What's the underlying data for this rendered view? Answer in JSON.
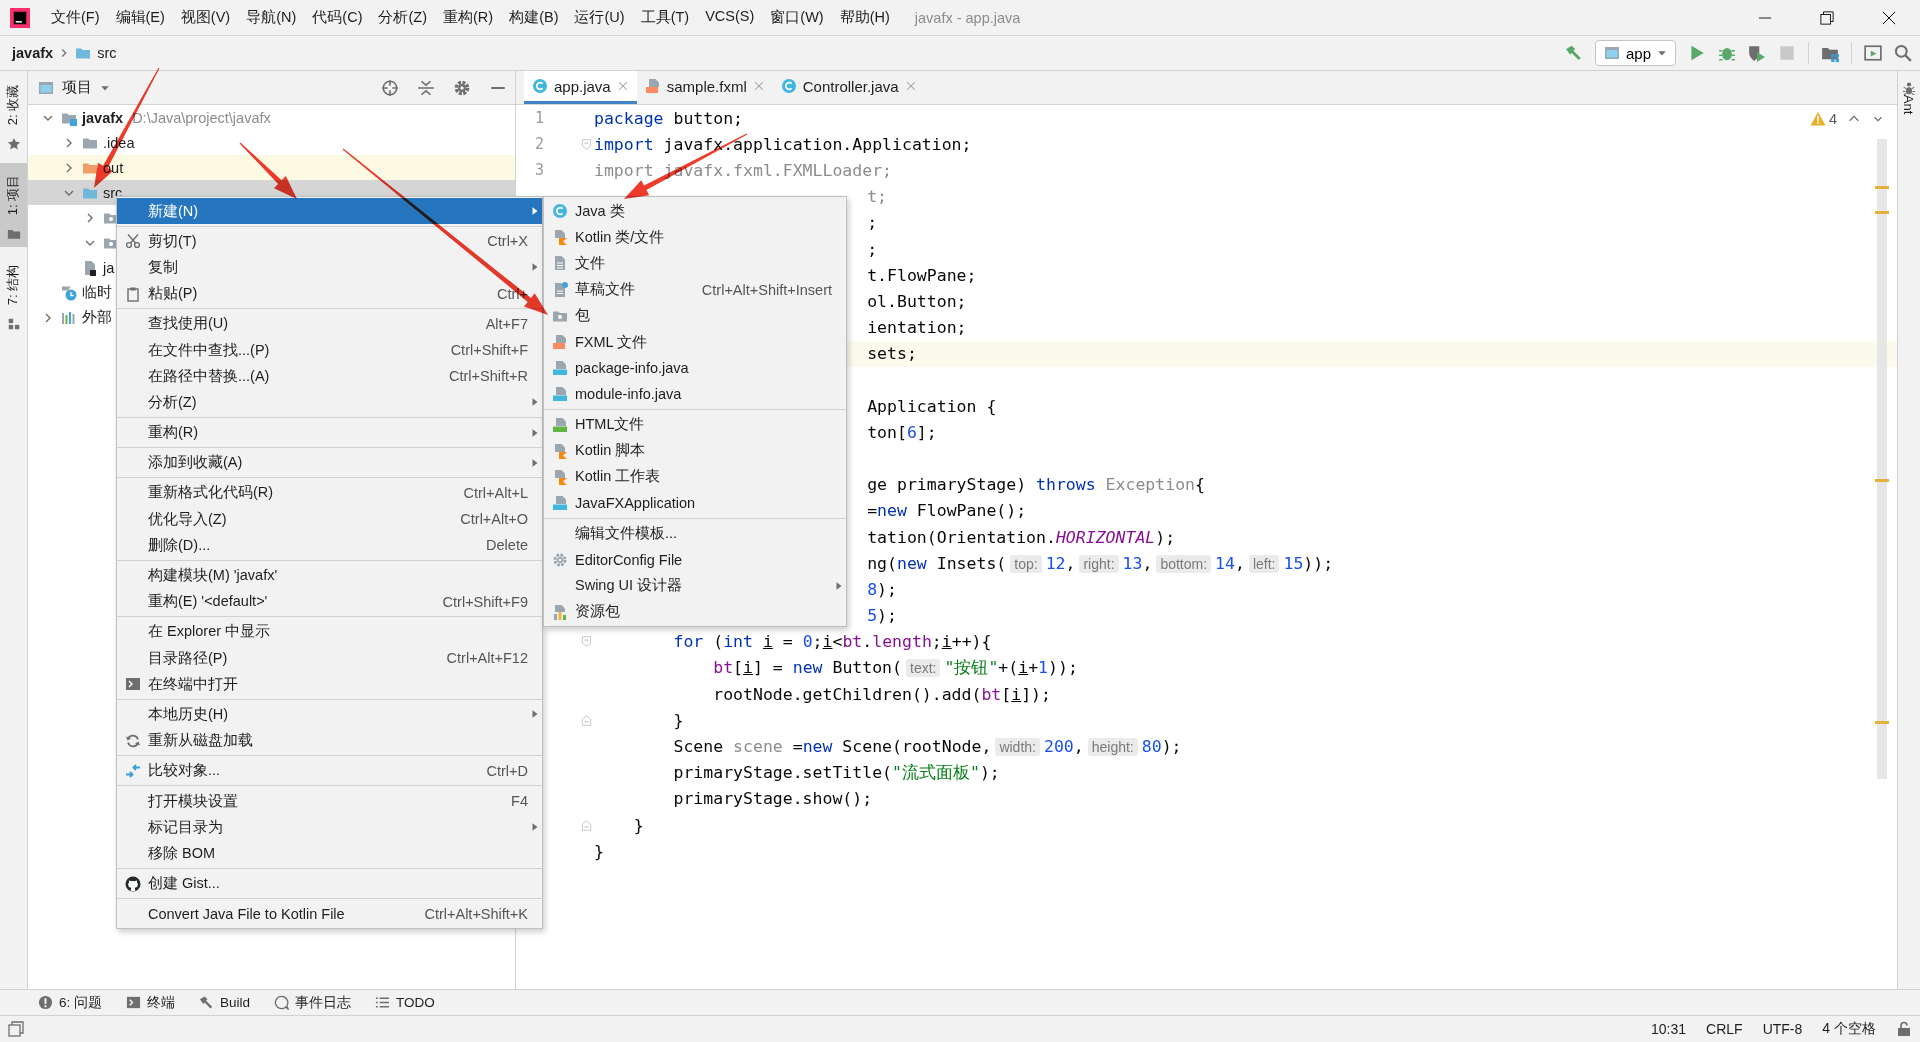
{
  "title_bar": {
    "menus": [
      "文件(F)",
      "编辑(E)",
      "视图(V)",
      "导航(N)",
      "代码(C)",
      "分析(Z)",
      "重构(R)",
      "构建(B)",
      "运行(U)",
      "工具(T)",
      "VCS(S)",
      "窗口(W)",
      "帮助(H)"
    ],
    "title": "javafx - app.java"
  },
  "nav_bar": {
    "breadcrumb": [
      "javafx",
      "src"
    ],
    "run_config": "app"
  },
  "left_strip": [
    {
      "label": "2: 收藏",
      "kind": "favorites",
      "selected": false
    },
    {
      "label": "1: 项目",
      "kind": "project",
      "selected": true
    },
    {
      "label": "7: 结构",
      "kind": "structure",
      "selected": false
    }
  ],
  "project_panel": {
    "title": "项目",
    "tree": [
      {
        "label": "javafx",
        "path": "D:\\Java\\project\\javafx",
        "kind": "module",
        "expanded": true,
        "selected": false,
        "children": [
          {
            "label": ".idea",
            "kind": "folder",
            "expanded": false,
            "selected": false
          },
          {
            "label": "out",
            "kind": "excluded",
            "expanded": false,
            "selected": false
          },
          {
            "label": "src",
            "kind": "source",
            "expanded": true,
            "selected": true,
            "children": [
              {
                "kind": "package",
                "expanded": false,
                "selected": false
              },
              {
                "kind": "package",
                "expanded": true,
                "selected": false
              }
            ]
          },
          {
            "label": "ja",
            "kind": "iml",
            "selected": false
          }
        ]
      },
      {
        "label": "临时",
        "kind": "scratches",
        "selected": false
      },
      {
        "label": "外部",
        "kind": "libraries",
        "expanded": false,
        "selected": false
      }
    ]
  },
  "editor": {
    "tabs": [
      {
        "label": "app.java",
        "kind": "class",
        "selected": true
      },
      {
        "label": "sample.fxml",
        "kind": "fxml",
        "selected": false
      },
      {
        "label": "Controller.java",
        "kind": "class",
        "selected": false
      }
    ],
    "warnings": "4",
    "lines": [
      {
        "kind": "full",
        "number": "1",
        "current": false,
        "tokens": [
          {
            "kind": "kw",
            "text": "package"
          },
          {
            "kind": "p",
            "text": " button;"
          }
        ]
      },
      {
        "kind": "full",
        "number": "2",
        "current": false,
        "fold_start": true,
        "tokens": [
          {
            "kind": "kw",
            "text": "import"
          },
          {
            "kind": "p",
            "text": " javafx.application.Application;"
          }
        ]
      },
      {
        "kind": "full",
        "number": "3",
        "current": false,
        "tokens": [
          {
            "kind": "grey",
            "text": "import javafx.fxml.FXMLLoader;"
          }
        ]
      },
      {
        "kind": "clipped",
        "current": false,
        "tokens": [
          {
            "kind": "grey",
            "text": "t;"
          }
        ]
      },
      {
        "kind": "clipped",
        "current": false,
        "tokens": [
          {
            "kind": "p",
            "text": ";"
          }
        ]
      },
      {
        "kind": "clipped",
        "current": false,
        "tokens": [
          {
            "kind": "p",
            "text": ";"
          }
        ]
      },
      {
        "kind": "clipped",
        "current": false,
        "tokens": [
          {
            "kind": "p",
            "text": "t.FlowPane;"
          }
        ]
      },
      {
        "kind": "clipped",
        "current": false,
        "tokens": [
          {
            "kind": "p",
            "text": "ol.Button;"
          }
        ]
      },
      {
        "kind": "clipped",
        "current": false,
        "tokens": [
          {
            "kind": "p",
            "text": "ientation;"
          }
        ]
      },
      {
        "kind": "clipped",
        "current": true,
        "tokens": [
          {
            "kind": "p",
            "text": "sets;"
          }
        ]
      },
      {
        "kind": "blank"
      },
      {
        "kind": "clipped",
        "current": false,
        "tokens": [
          {
            "kind": "p",
            "text": "Application {"
          }
        ]
      },
      {
        "kind": "clipped",
        "current": false,
        "tokens": [
          {
            "kind": "p",
            "text": "ton["
          },
          {
            "kind": "num",
            "text": "6"
          },
          {
            "kind": "p",
            "text": "];"
          }
        ]
      },
      {
        "kind": "blank"
      },
      {
        "kind": "clipped",
        "current": false,
        "tokens": [
          {
            "kind": "p",
            "text": "ge primaryStage) "
          },
          {
            "kind": "kw",
            "text": "throws"
          },
          {
            "kind": "grey",
            "text": " Exception"
          },
          {
            "kind": "p",
            "text": "{"
          }
        ]
      },
      {
        "kind": "clipped",
        "current": false,
        "tokens": [
          {
            "kind": "p",
            "text": "="
          },
          {
            "kind": "kw",
            "text": "new"
          },
          {
            "kind": "p",
            "text": " FlowPane();"
          }
        ]
      },
      {
        "kind": "clipped",
        "current": false,
        "tokens": [
          {
            "kind": "p",
            "text": "tation(Orientation."
          },
          {
            "kind": "const",
            "text": "HORIZONTAL"
          },
          {
            "kind": "p",
            "text": ");"
          }
        ]
      },
      {
        "kind": "clipped",
        "current": false,
        "tokens": [
          {
            "kind": "p",
            "text": "ng("
          },
          {
            "kind": "kw",
            "text": "new"
          },
          {
            "kind": "p",
            "text": " Insets("
          },
          {
            "kind": "hint",
            "text": "top:"
          },
          {
            "kind": "num",
            "text": "12"
          },
          {
            "kind": "p",
            "text": ","
          },
          {
            "kind": "hint",
            "text": "right:"
          },
          {
            "kind": "num",
            "text": "13"
          },
          {
            "kind": "p",
            "text": ","
          },
          {
            "kind": "hint",
            "text": "bottom:"
          },
          {
            "kind": "num",
            "text": "14"
          },
          {
            "kind": "p",
            "text": ","
          },
          {
            "kind": "hint",
            "text": "left:"
          },
          {
            "kind": "num",
            "text": "15"
          },
          {
            "kind": "p",
            "text": "));"
          }
        ]
      },
      {
        "kind": "clipped",
        "current": false,
        "tokens": [
          {
            "kind": "num",
            "text": "8"
          },
          {
            "kind": "p",
            "text": ");"
          }
        ]
      },
      {
        "kind": "clipped",
        "current": false,
        "tokens": [
          {
            "kind": "num",
            "text": "5"
          },
          {
            "kind": "p",
            "text": ");"
          }
        ]
      },
      {
        "kind": "full",
        "current": false,
        "fold_start": true,
        "tokens": [
          {
            "kind": "kw",
            "text": "        for"
          },
          {
            "kind": "p",
            "text": " ("
          },
          {
            "kind": "kw",
            "text": "int "
          },
          {
            "kind": "var",
            "text": "i"
          },
          {
            "kind": "p",
            "text": " = "
          },
          {
            "kind": "num",
            "text": "0"
          },
          {
            "kind": "p",
            "text": ";"
          },
          {
            "kind": "var",
            "text": "i"
          },
          {
            "kind": "p",
            "text": "<"
          },
          {
            "kind": "field",
            "text": "bt"
          },
          {
            "kind": "p",
            "text": "."
          },
          {
            "kind": "field",
            "text": "length"
          },
          {
            "kind": "p",
            "text": ";"
          },
          {
            "kind": "var",
            "text": "i"
          },
          {
            "kind": "p",
            "text": "++){"
          }
        ]
      },
      {
        "kind": "full",
        "current": false,
        "tokens": [
          {
            "kind": "field",
            "text": "            bt"
          },
          {
            "kind": "p",
            "text": "["
          },
          {
            "kind": "var",
            "text": "i"
          },
          {
            "kind": "p",
            "text": "] = "
          },
          {
            "kind": "kw",
            "text": "new"
          },
          {
            "kind": "p",
            "text": " Button("
          },
          {
            "kind": "hint",
            "text": "text:"
          },
          {
            "kind": "str",
            "text": "\"按钮\""
          },
          {
            "kind": "p",
            "text": "+("
          },
          {
            "kind": "var",
            "text": "i"
          },
          {
            "kind": "p",
            "text": "+"
          },
          {
            "kind": "num",
            "text": "1"
          },
          {
            "kind": "p",
            "text": "));"
          }
        ]
      },
      {
        "kind": "full",
        "current": false,
        "tokens": [
          {
            "kind": "p",
            "text": "            rootNode.getChildren().add("
          },
          {
            "kind": "field",
            "text": "bt"
          },
          {
            "kind": "p",
            "text": "["
          },
          {
            "kind": "var",
            "text": "i"
          },
          {
            "kind": "p",
            "text": "]);"
          }
        ]
      },
      {
        "kind": "full",
        "current": false,
        "fold_end": true,
        "tokens": [
          {
            "kind": "p",
            "text": "        }"
          }
        ]
      },
      {
        "kind": "full",
        "current": false,
        "tokens": [
          {
            "kind": "p",
            "text": "        Scene "
          },
          {
            "kind": "grey",
            "text": "scene"
          },
          {
            "kind": "p",
            "text": " ="
          },
          {
            "kind": "kw",
            "text": "new"
          },
          {
            "kind": "p",
            "text": " Scene(rootNode,"
          },
          {
            "kind": "hint",
            "text": "width:"
          },
          {
            "kind": "num",
            "text": "200"
          },
          {
            "kind": "p",
            "text": ","
          },
          {
            "kind": "hint",
            "text": "height:"
          },
          {
            "kind": "num",
            "text": "80"
          },
          {
            "kind": "p",
            "text": ");"
          }
        ]
      },
      {
        "kind": "full",
        "current": false,
        "tokens": [
          {
            "kind": "p",
            "text": "        primaryStage.setTitle("
          },
          {
            "kind": "str",
            "text": "\"流式面板\""
          },
          {
            "kind": "p",
            "text": ");"
          }
        ]
      },
      {
        "kind": "full",
        "current": false,
        "tokens": [
          {
            "kind": "p",
            "text": "        primaryStage.show();"
          }
        ]
      },
      {
        "kind": "full",
        "current": false,
        "fold_end": true,
        "tokens": [
          {
            "kind": "p",
            "text": "    }"
          }
        ]
      },
      {
        "kind": "full",
        "current": false,
        "tokens": [
          {
            "kind": "p",
            "text": "}"
          }
        ]
      }
    ]
  },
  "right_strip": [
    {
      "label": "Ant",
      "kind": "ant"
    }
  ],
  "context_menu": {
    "groups": [
      [
        {
          "label": "新建(N)",
          "kind": "plain",
          "submenu": true,
          "selected": true
        }
      ],
      [
        {
          "label": "剪切(T)",
          "shortcut": "Ctrl+X",
          "kind": "cut",
          "submenu": false,
          "selected": false
        },
        {
          "label": "复制",
          "kind": "plain",
          "submenu": true,
          "selected": false
        },
        {
          "label": "粘贴(P)",
          "shortcut": "Ctrl+",
          "kind": "paste",
          "submenu": false,
          "selected": false
        }
      ],
      [
        {
          "label": "查找使用(U)",
          "shortcut": "Alt+F7",
          "kind": "plain",
          "submenu": false,
          "selected": false
        },
        {
          "label": "在文件中查找...(P)",
          "shortcut": "Ctrl+Shift+F",
          "kind": "plain",
          "submenu": false,
          "selected": false
        },
        {
          "label": "在路径中替换...(A)",
          "shortcut": "Ctrl+Shift+R",
          "kind": "plain",
          "submenu": false,
          "selected": false
        },
        {
          "label": "分析(Z)",
          "kind": "plain",
          "submenu": true,
          "selected": false
        }
      ],
      [
        {
          "label": "重构(R)",
          "kind": "plain",
          "submenu": true,
          "selected": false
        }
      ],
      [
        {
          "label": "添加到收藏(A)",
          "kind": "plain",
          "submenu": true,
          "selected": false
        }
      ],
      [
        {
          "label": "重新格式化代码(R)",
          "shortcut": "Ctrl+Alt+L",
          "kind": "plain",
          "submenu": false,
          "selected": false
        },
        {
          "label": "优化导入(Z)",
          "shortcut": "Ctrl+Alt+O",
          "kind": "plain",
          "submenu": false,
          "selected": false
        },
        {
          "label": "删除(D)...",
          "shortcut": "Delete",
          "kind": "plain",
          "submenu": false,
          "selected": false
        }
      ],
      [
        {
          "label": "构建模块(M) 'javafx'",
          "kind": "plain",
          "submenu": false,
          "selected": false
        },
        {
          "label": "重构(E) '<default>'",
          "shortcut": "Ctrl+Shift+F9",
          "kind": "plain",
          "submenu": false,
          "selected": false
        }
      ],
      [
        {
          "label": "在 Explorer 中显示",
          "kind": "plain",
          "submenu": false,
          "selected": false
        },
        {
          "label": "目录路径(P)",
          "shortcut": "Ctrl+Alt+F12",
          "kind": "plain",
          "submenu": false,
          "selected": false
        },
        {
          "label": "在终端中打开",
          "kind": "terminal",
          "submenu": false,
          "selected": false
        }
      ],
      [
        {
          "label": "本地历史(H)",
          "kind": "plain",
          "submenu": true,
          "selected": false
        },
        {
          "label": "重新从磁盘加载",
          "kind": "reload",
          "submenu": false,
          "selected": false
        }
      ],
      [
        {
          "label": "比较对象...",
          "shortcut": "Ctrl+D",
          "kind": "compare",
          "submenu": false,
          "selected": false
        }
      ],
      [
        {
          "label": "打开模块设置",
          "shortcut": "F4",
          "kind": "plain",
          "submenu": false,
          "selected": false
        },
        {
          "label": "标记目录为",
          "kind": "plain",
          "submenu": true,
          "selected": false
        },
        {
          "label": "移除 BOM",
          "kind": "plain",
          "submenu": false,
          "selected": false
        }
      ],
      [
        {
          "label": "创建 Gist...",
          "kind": "github",
          "submenu": false,
          "selected": false
        }
      ],
      [
        {
          "label": "Convert Java File to Kotlin File",
          "shortcut": "Ctrl+Alt+Shift+K",
          "kind": "plain",
          "submenu": false,
          "selected": false
        }
      ]
    ]
  },
  "submenu": {
    "groups": [
      [
        {
          "label": "Java 类",
          "kind": "class",
          "submenu": false
        },
        {
          "label": "Kotlin 类/文件",
          "kind": "kotlin",
          "submenu": false
        },
        {
          "label": "文件",
          "kind": "file",
          "submenu": false
        },
        {
          "label": "草稿文件",
          "shortcut": "Ctrl+Alt+Shift+Insert",
          "kind": "scratch",
          "submenu": false
        },
        {
          "label": "包",
          "kind": "package",
          "submenu": false
        },
        {
          "label": "FXML 文件",
          "kind": "fxml",
          "submenu": false
        },
        {
          "label": "package-info.java",
          "kind": "java",
          "submenu": false
        },
        {
          "label": "module-info.java",
          "kind": "java",
          "submenu": false
        }
      ],
      [
        {
          "label": "HTML文件",
          "kind": "html",
          "submenu": false
        },
        {
          "label": "Kotlin 脚本",
          "kind": "kotlin",
          "submenu": false
        },
        {
          "label": "Kotlin 工作表",
          "kind": "kotlin",
          "submenu": false
        },
        {
          "label": "JavaFXApplication",
          "kind": "java",
          "submenu": false
        }
      ],
      [
        {
          "label": "编辑文件模板...",
          "kind": "plain",
          "submenu": false
        },
        {
          "label": "EditorConfig File",
          "kind": "gear",
          "submenu": false
        },
        {
          "label": "Swing UI 设计器",
          "kind": "plain",
          "submenu": true
        },
        {
          "label": "资源包",
          "kind": "bundle",
          "submenu": false
        }
      ]
    ]
  },
  "bottom_tools": [
    {
      "label": "6: 问题",
      "kind": "problems"
    },
    {
      "label": "终端",
      "kind": "terminal"
    },
    {
      "label": "Build",
      "kind": "build"
    },
    {
      "label": "事件日志",
      "kind": "log"
    },
    {
      "label": "TODO",
      "kind": "todo"
    }
  ],
  "status_bar": [
    "10:31",
    "CRLF",
    "UTF-8",
    "4 个空格"
  ]
}
